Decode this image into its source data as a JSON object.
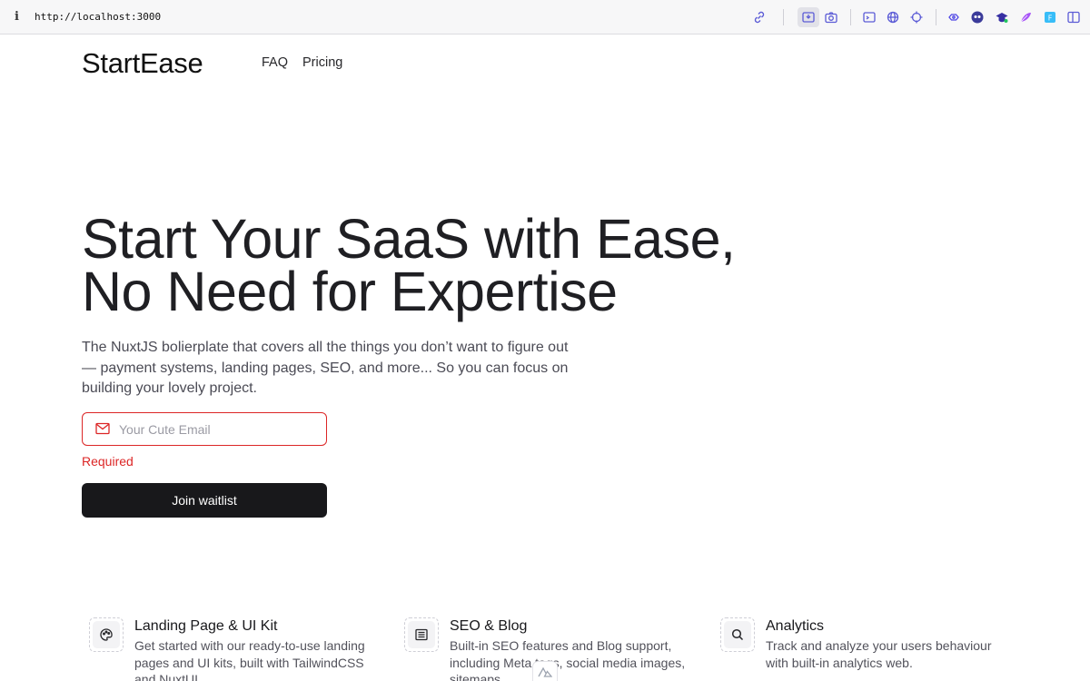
{
  "browser": {
    "info_glyph": "i",
    "url": "http://localhost:3000"
  },
  "site": {
    "logo": "StartEase",
    "nav": [
      {
        "label": "FAQ"
      },
      {
        "label": "Pricing"
      }
    ]
  },
  "hero": {
    "title_line1": "Start Your SaaS with Ease,",
    "title_line2": "No Need for Expertise",
    "description": "The NuxtJS bolierplate that covers all the things you don’t want to figure out — payment systems, landing pages, SEO, and more... So you can focus on building your lovely project.",
    "email_placeholder": "Your Cute Email",
    "email_value": "",
    "error": "Required",
    "cta": "Join waitlist"
  },
  "features": [
    {
      "icon": "palette-icon",
      "title": "Landing Page & UI Kit",
      "description": "Get started with our ready-to-use landing pages and UI kits, built with TailwindCSS and NuxtUI"
    },
    {
      "icon": "newspaper-icon",
      "title": "SEO & Blog",
      "description": "Built-in SEO features and Blog support, including Meta tags, social media images, sitemaps"
    },
    {
      "icon": "search-icon",
      "title": "Analytics",
      "description": "Track and analyze your users behaviour with built-in analytics web."
    }
  ],
  "colors": {
    "error": "#dc2626",
    "button_bg": "#18181b",
    "text_muted": "#4b4b55"
  }
}
